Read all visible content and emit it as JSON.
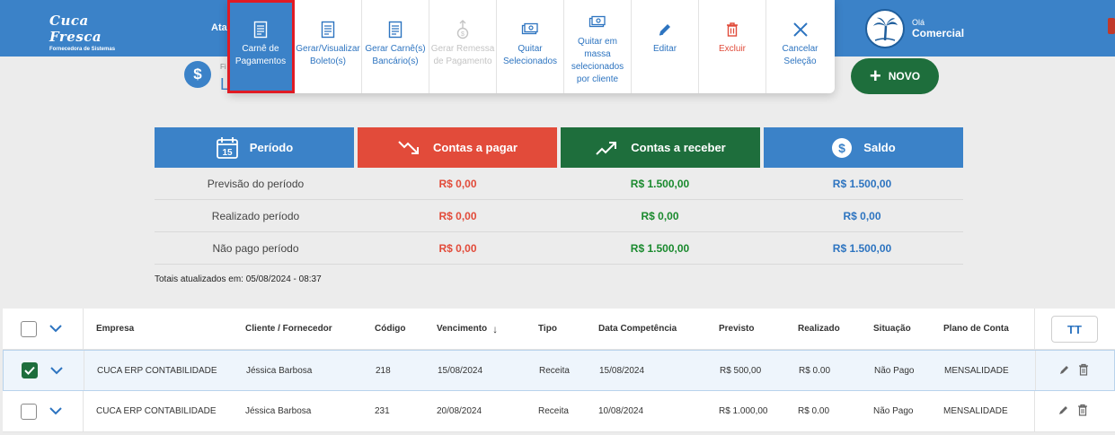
{
  "header": {
    "logo_text": "Cuca Fresca",
    "logo_tagline": "Fornecedora de Sistemas",
    "nav_partial": "Ata",
    "greeting": "Olá",
    "user_name": "Comercial"
  },
  "toolbar": {
    "buttons": [
      {
        "label": "Carnê de Pagamentos",
        "icon": "document-icon",
        "state": "selected"
      },
      {
        "label": "Gerar/Visualizar Boleto(s)",
        "icon": "document-icon",
        "state": "normal"
      },
      {
        "label": "Gerar Carnê(s) Bancário(s)",
        "icon": "document-icon",
        "state": "normal"
      },
      {
        "label": "Gerar Remessa de Pagamento",
        "icon": "upload-coin-icon",
        "state": "disabled"
      },
      {
        "label": "Quitar Selecionados",
        "icon": "cash-icon",
        "state": "normal"
      },
      {
        "label": "Quitar em massa selecionados por cliente",
        "icon": "cash-icon",
        "state": "normal"
      },
      {
        "label": "Editar",
        "icon": "pencil-icon",
        "state": "normal"
      },
      {
        "label": "Excluir",
        "icon": "trash-icon",
        "state": "danger"
      },
      {
        "label": "Cancelar Seleção",
        "icon": "close-icon",
        "state": "normal"
      }
    ]
  },
  "page": {
    "title_small": "Fi",
    "title_big": "L",
    "new_button": "NOVO"
  },
  "summary": {
    "headers": {
      "periodo": "Período",
      "pagar": "Contas a pagar",
      "receber": "Contas a receber",
      "saldo": "Saldo"
    },
    "rows": [
      {
        "label": "Previsão do período",
        "pagar": "R$ 0,00",
        "receber": "R$ 1.500,00",
        "saldo": "R$ 1.500,00"
      },
      {
        "label": "Realizado período",
        "pagar": "R$ 0,00",
        "receber": "R$ 0,00",
        "saldo": "R$ 0,00"
      },
      {
        "label": "Não pago período",
        "pagar": "R$ 0,00",
        "receber": "R$ 1.500,00",
        "saldo": "R$ 1.500,00"
      }
    ],
    "totals_text": "Totais atualizados em: 05/08/2024 - 08:37",
    "calendar_day": "15"
  },
  "table": {
    "columns": {
      "empresa": "Empresa",
      "cliente": "Cliente / Fornecedor",
      "codigo": "Código",
      "vencimento": "Vencimento",
      "tipo": "Tipo",
      "competencia": "Data Competência",
      "previsto": "Previsto",
      "realizado": "Realizado",
      "situacao": "Situação",
      "plano": "Plano de Conta"
    },
    "sort_arrow": "↓",
    "columns_button": "TT",
    "rows": [
      {
        "checked": true,
        "empresa": "CUCA ERP CONTABILIDADE",
        "cliente": "Jéssica Barbosa",
        "codigo": "218",
        "vencimento": "15/08/2024",
        "tipo": "Receita",
        "competencia": "15/08/2024",
        "previsto": "R$ 500,00",
        "realizado": "R$ 0.00",
        "situacao": "Não Pago",
        "plano": "MENSALIDADE"
      },
      {
        "checked": false,
        "empresa": "CUCA ERP CONTABILIDADE",
        "cliente": "Jéssica Barbosa",
        "codigo": "231",
        "vencimento": "20/08/2024",
        "tipo": "Receita",
        "competencia": "10/08/2024",
        "previsto": "R$ 1.000,00",
        "realizado": "R$ 0.00",
        "situacao": "Não Pago",
        "plano": "MENSALIDADE"
      }
    ]
  },
  "colors": {
    "primary": "#3b82c8",
    "danger": "#e24b3a",
    "success": "#1e6e3c",
    "highlight_border": "#e01b24"
  }
}
